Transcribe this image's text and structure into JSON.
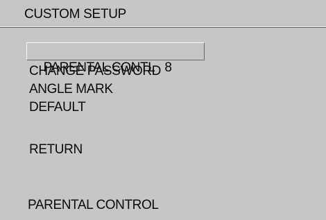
{
  "header": {
    "title": "CUSTOM SETUP"
  },
  "menu": {
    "items": [
      {
        "label": "PARENTAL CONTL",
        "value": "8"
      },
      {
        "label": "CHANGE PASSWORD"
      },
      {
        "label": "ANGLE MARK"
      },
      {
        "label": "DEFAULT"
      }
    ],
    "return_label": "RETURN"
  },
  "footer": {
    "status": "PARENTAL CONTROL"
  }
}
